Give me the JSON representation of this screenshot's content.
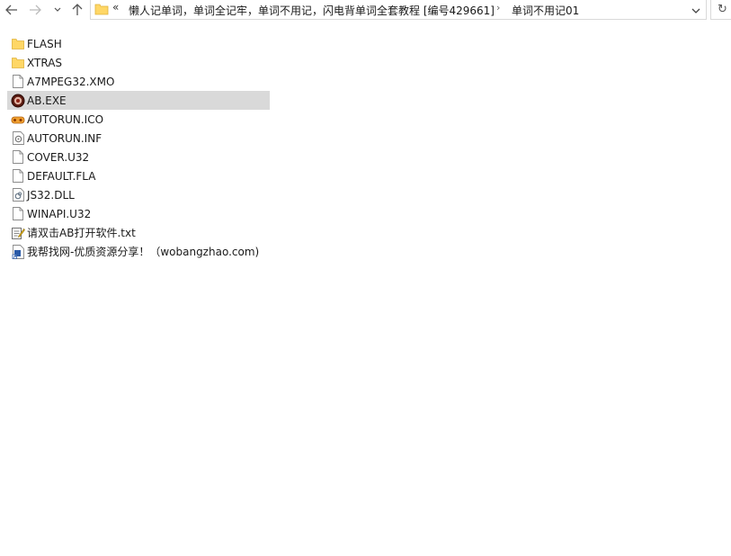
{
  "navigation": {
    "back_icon": "arrow-left-icon",
    "forward_icon": "arrow-right-icon",
    "history_icon": "chevron-down-icon",
    "up_icon": "arrow-up-icon"
  },
  "address_bar": {
    "overflow_marker": "«",
    "path": [
      "懒人记单词，单词全记牢，单词不用记，闪电背单词全套教程 [编号429661]",
      "单词不用记01"
    ],
    "separator": "›",
    "dropdown_icon": "chevron-down-icon",
    "refresh_symbol": "↻"
  },
  "files": [
    {
      "name": "FLASH",
      "icon": "folder-icon"
    },
    {
      "name": "XTRAS",
      "icon": "folder-icon"
    },
    {
      "name": "A7MPEG32.XMO",
      "icon": "file-icon"
    },
    {
      "name": "AB.EXE",
      "icon": "app-exe-icon",
      "selected": true
    },
    {
      "name": "AUTORUN.ICO",
      "icon": "ico-file-icon"
    },
    {
      "name": "AUTORUN.INF",
      "icon": "settings-file-icon"
    },
    {
      "name": "COVER.U32",
      "icon": "file-icon"
    },
    {
      "name": "DEFAULT.FLA",
      "icon": "file-icon"
    },
    {
      "name": "JS32.DLL",
      "icon": "dll-file-icon"
    },
    {
      "name": "WINAPI.U32",
      "icon": "file-icon"
    },
    {
      "name": "请双击AB打开软件.txt",
      "icon": "text-file-icon"
    },
    {
      "name": "我帮找网-优质资源分享！（wobangzhao.com)",
      "icon": "shortcut-icon"
    }
  ],
  "colors": {
    "folder": "#ffd766",
    "selection": "#d9d9d9",
    "border": "#d9d9d9"
  }
}
